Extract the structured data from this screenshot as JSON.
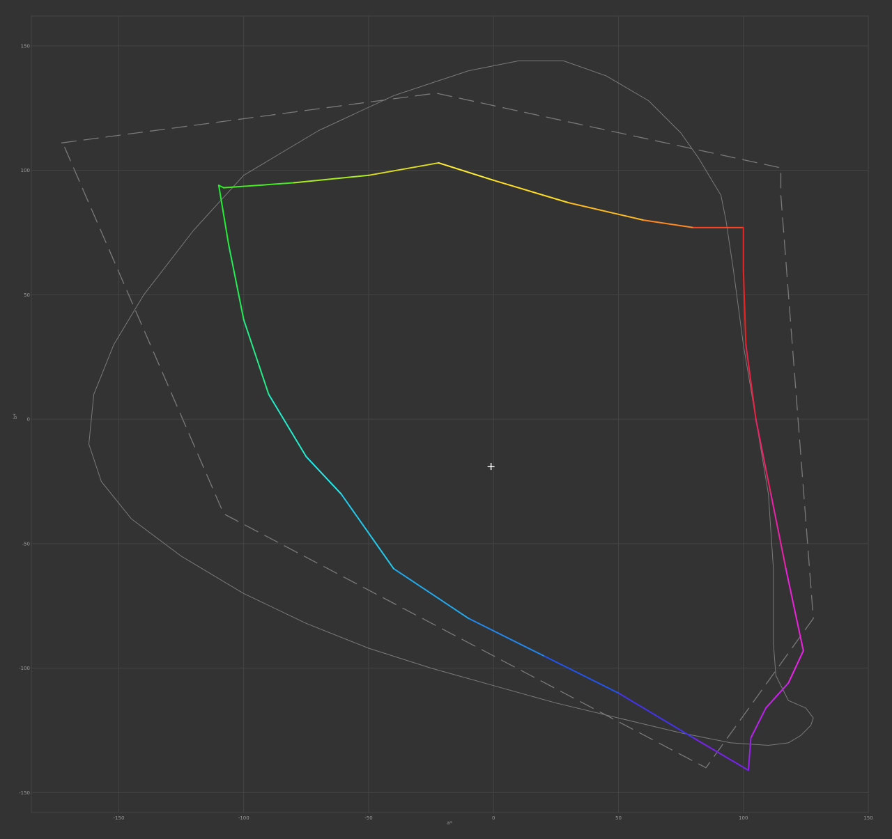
{
  "chart_data": {
    "type": "line",
    "title": "",
    "xlabel": "a*",
    "ylabel": "b*",
    "xlim": [
      -185,
      150
    ],
    "ylim": [
      -158,
      162
    ],
    "x_ticks": [
      -150,
      -100,
      -50,
      0,
      50,
      100,
      150
    ],
    "y_ticks": [
      150,
      100,
      50,
      0,
      -50,
      -100,
      -150
    ],
    "grid": true,
    "colors": {
      "background": "#333333",
      "grid": "#444444",
      "reference_lines": "#7a7a7a"
    },
    "white_point": {
      "a": -1,
      "b": -19
    },
    "series": [
      {
        "style": "solid-gray",
        "x": [
          28,
          10,
          -10,
          -40,
          -70,
          -100,
          -120,
          -140,
          -152,
          -160,
          -162,
          -157,
          -145,
          -125,
          -100,
          -75,
          -50,
          -25,
          0,
          25,
          50,
          75,
          95,
          110,
          118,
          123,
          127,
          128,
          125,
          118,
          113,
          112,
          112,
          110,
          105,
          100,
          96,
          93,
          91,
          88,
          82,
          75,
          62,
          45,
          28
        ],
        "y": [
          144,
          144,
          140,
          130,
          116,
          98,
          76,
          50,
          30,
          10,
          -10,
          -25,
          -40,
          -55,
          -70,
          -82,
          -92,
          -100,
          -107,
          -114,
          -120,
          -126,
          -130,
          -131,
          -130,
          -127,
          -123,
          -120,
          -116,
          -113,
          -103,
          -90,
          -60,
          -30,
          0,
          30,
          60,
          80,
          90,
          95,
          105,
          115,
          128,
          138,
          144
        ]
      },
      {
        "style": "dashed-gray",
        "x": [
          -173,
          -23,
          115,
          115,
          128,
          85,
          -108,
          -172,
          -173
        ],
        "y": [
          111,
          131,
          101,
          90,
          -80,
          -140,
          -38,
          110,
          111
        ]
      },
      {
        "style": "gradient-gamut",
        "x": [
          -110,
          -108,
          -80,
          -50,
          -22,
          0,
          30,
          60,
          80,
          100,
          100,
          101,
          105,
          111,
          117,
          124,
          118,
          109,
          103,
          102,
          80,
          50,
          20,
          -10,
          -40,
          -61,
          -75,
          -90,
          -100,
          -106,
          -110,
          -110
        ],
        "y": [
          94,
          93,
          95,
          98,
          103,
          96,
          87,
          80,
          77,
          77,
          60,
          30,
          0,
          -30,
          -60,
          -93,
          -106,
          -116,
          -128,
          -141,
          -128,
          -110,
          -95,
          -80,
          -60,
          -30,
          -15,
          10,
          40,
          70,
          94,
          94
        ],
        "colors": [
          "#22ee22",
          "#44ee22",
          "#aaee22",
          "#dddd22",
          "#ffee33",
          "#ffdd22",
          "#ffbb22",
          "#ff8822",
          "#ff4422",
          "#ee2222",
          "#ee2222",
          "#ee2244",
          "#ee2266",
          "#ee22aa",
          "#ee22dd",
          "#ee22ee",
          "#cc22ee",
          "#bb22ee",
          "#9922ee",
          "#7722ee",
          "#4433ee",
          "#2255ee",
          "#2288ee",
          "#22aaee",
          "#22ccee",
          "#22eeee",
          "#22eecc",
          "#22ee88",
          "#22ee55",
          "#22ee33",
          "#22ee22",
          "#22ee22"
        ]
      }
    ]
  }
}
